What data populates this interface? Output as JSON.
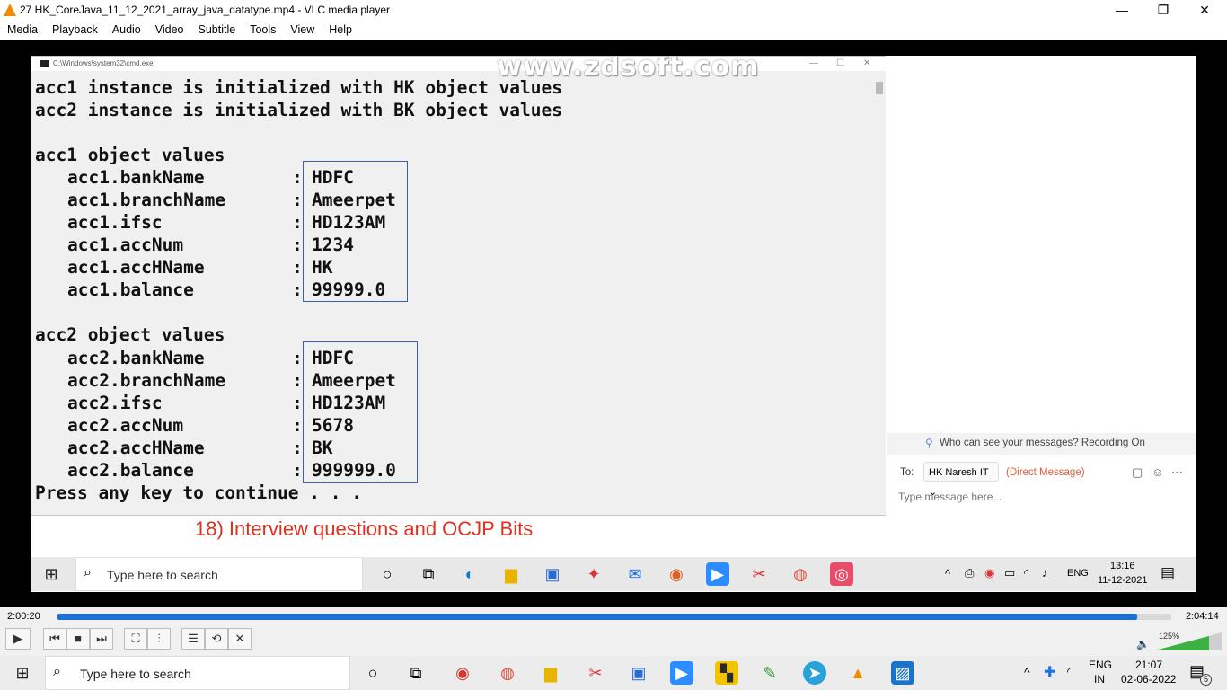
{
  "window": {
    "title": "27 HK_CoreJava_11_12_2021_array_java_datatype.mp4 - VLC media player",
    "minimize": "—",
    "restore": "❐",
    "close": "✕"
  },
  "menu": [
    "Media",
    "Playback",
    "Audio",
    "Video",
    "Subtitle",
    "Tools",
    "View",
    "Help"
  ],
  "video": {
    "cmd": {
      "path": "C:\\Windows\\system32\\cmd.exe",
      "watermark": "www.zdsoft.com",
      "intro": [
        "acc1 instance is initialized with HK object values",
        "acc2 instance is initialized with BK object values"
      ],
      "groups": [
        {
          "heading": "acc1 object values",
          "rows": [
            {
              "label": "acc1.bankName",
              "value": "HDFC"
            },
            {
              "label": "acc1.branchName",
              "value": "Ameerpet"
            },
            {
              "label": "acc1.ifsc",
              "value": "HD123AM"
            },
            {
              "label": "acc1.accNum",
              "value": "1234"
            },
            {
              "label": "acc1.accHName",
              "value": "HK"
            },
            {
              "label": "acc1.balance",
              "value": "99999.0"
            }
          ]
        },
        {
          "heading": "acc2 object values",
          "rows": [
            {
              "label": "acc2.bankName",
              "value": "HDFC"
            },
            {
              "label": "acc2.branchName",
              "value": "Ameerpet"
            },
            {
              "label": "acc2.ifsc",
              "value": "HD123AM"
            },
            {
              "label": "acc2.accNum",
              "value": "5678"
            },
            {
              "label": "acc2.accHName",
              "value": "BK"
            },
            {
              "label": "acc2.balance",
              "value": "999999.0"
            }
          ]
        }
      ],
      "colon": ":",
      "footer": "Press any key to continue . . ."
    },
    "banner": "18) Interview questions and OCJP Bits",
    "chat": {
      "note": "Who can see your messages? Recording On",
      "to_label": "To:",
      "recipient": "HK Naresh IT",
      "direct": "(Direct Message)",
      "placeholder": "Type message here..."
    },
    "inner_taskbar": {
      "search_placeholder": "Type here to search",
      "tray_lang": "ENG",
      "time": "13:16",
      "date": "11-12-2021"
    }
  },
  "player": {
    "elapsed": "2:00:20",
    "total": "2:04:14",
    "progress": 0.969,
    "volume": "125%"
  },
  "taskbar": {
    "search_placeholder": "Type here to search",
    "lang": "ENG",
    "region": "IN",
    "time": "21:07",
    "date": "02-06-2022",
    "notifications": "5"
  }
}
